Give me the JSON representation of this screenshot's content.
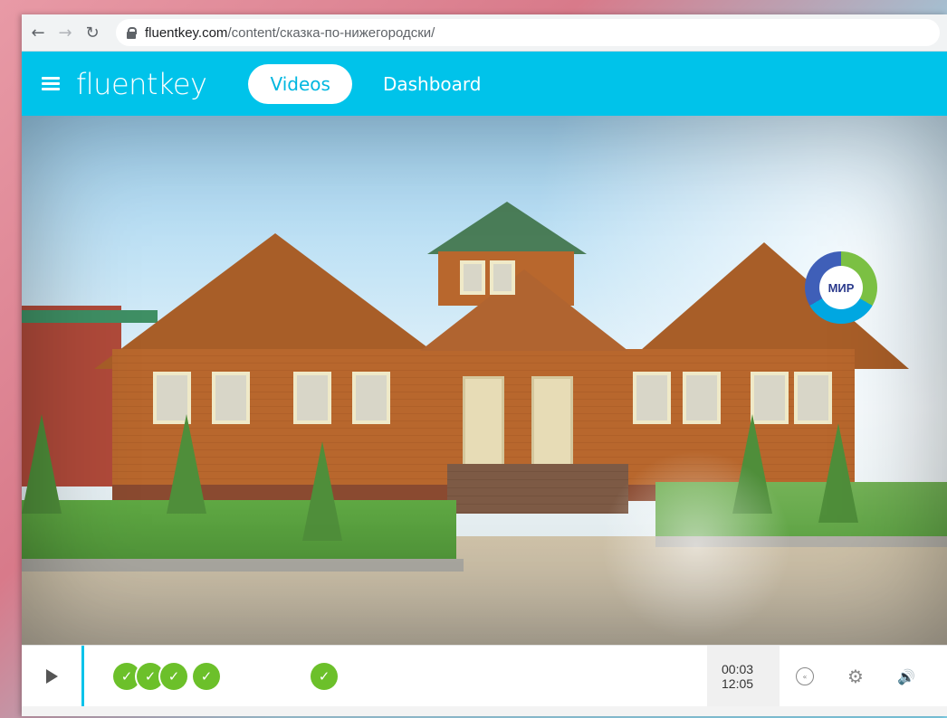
{
  "browser": {
    "back_icon": "←",
    "forward_icon": "→",
    "reload_icon": "↻",
    "url_domain": "fluentkey.com",
    "url_path": "/content/сказка-по-нижегородски/"
  },
  "header": {
    "brand": "fluentkey",
    "tabs": [
      {
        "label": "Videos",
        "active": true
      },
      {
        "label": "Dashboard",
        "active": false
      }
    ]
  },
  "video": {
    "channel_logo": "МИР"
  },
  "controls": {
    "check_mark": "✓",
    "time_current": "00:03",
    "time_total": "12:05",
    "rewind_icon": "«",
    "gear_icon": "⚙",
    "volume_icon": "🔊",
    "accent_color": "#00c3ea",
    "check_color": "#6cc02a"
  }
}
